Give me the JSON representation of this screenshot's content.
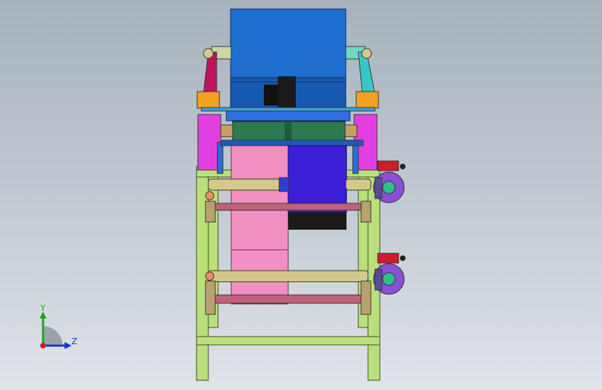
{
  "viewport": {
    "background_top": "#a7b2bd",
    "background_bottom": "#dfe4e9"
  },
  "triad": {
    "y_label": "Y",
    "z_label": "Z",
    "y_color": "#1aa31a",
    "z_color": "#1a2fd6",
    "x_color": "#d11a1a"
  },
  "model": {
    "icons": [
      "assembly-model"
    ],
    "colors": {
      "frame": "#b9e07a",
      "drum": "#1f6fd1",
      "magenta_plate": "#e23fe0",
      "pink_roll": "#f08fc0",
      "purple_roll": "#3a1fd6",
      "green_roll": "#2d7a52",
      "motor_body": "#8a4fd6",
      "motor_cap": "#d11a2a",
      "shaft": "#d4c98a",
      "orange_block": "#f2a020"
    }
  }
}
